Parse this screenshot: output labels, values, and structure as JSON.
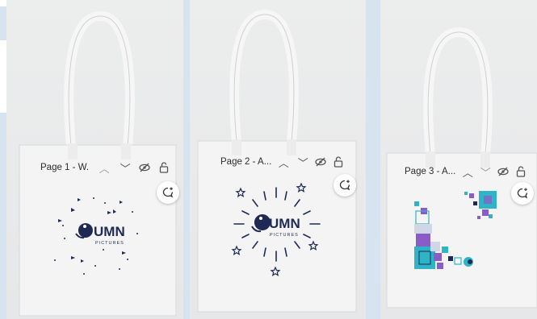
{
  "pages": [
    {
      "label": "Page 1 - W.",
      "logo_text": "UMN",
      "logo_subtext": "PICTURES"
    },
    {
      "label": "Page 2 - A...",
      "logo_text": "UMN",
      "logo_subtext": "PICTURES"
    },
    {
      "label": "Page 3 - A..."
    }
  ],
  "colors": {
    "ink": "#1e2a55",
    "teal": "#2fb3c7",
    "purple": "#8a5cc7",
    "bag": "#f4f4f4"
  },
  "icons": [
    "chevron-up-icon",
    "chevron-down-icon",
    "eye-off-icon",
    "lock-open-icon",
    "add-comment-icon"
  ]
}
